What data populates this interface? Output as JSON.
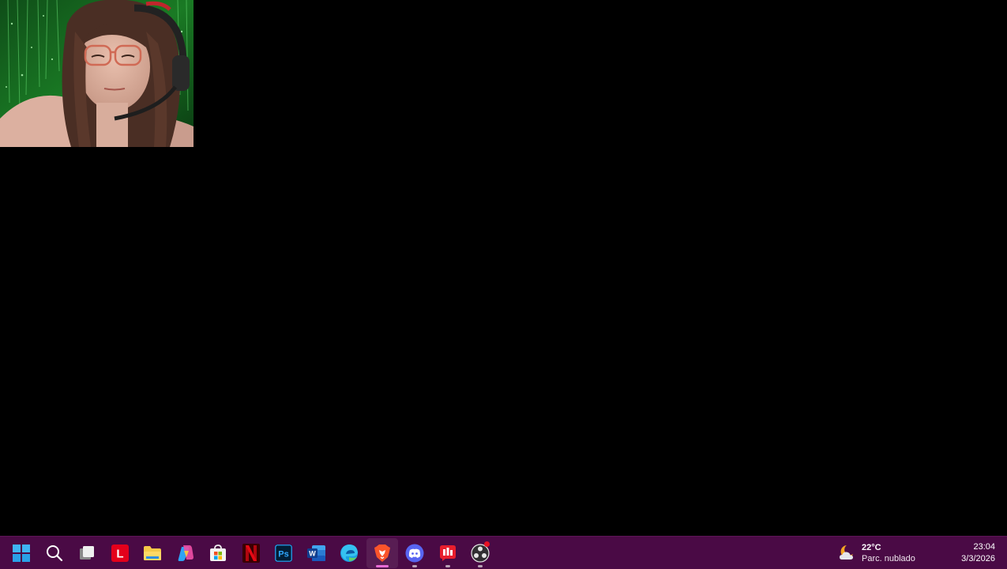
{
  "webcam": {
    "description_icon": "webcam-overlay"
  },
  "taskbar": {
    "background": "#4a0a45",
    "icons": [
      {
        "name": "start-button",
        "icon": "windows-icon",
        "running": false,
        "active": false
      },
      {
        "name": "search-button",
        "icon": "search-icon",
        "running": false,
        "active": false
      },
      {
        "name": "task-view-button",
        "icon": "task-view-icon",
        "running": false,
        "active": false
      },
      {
        "name": "taskbar-app-l",
        "icon": "l-app-icon",
        "label": "L",
        "running": false,
        "active": false
      },
      {
        "name": "taskbar-app-file-explorer",
        "icon": "folder-icon",
        "running": false,
        "active": false
      },
      {
        "name": "taskbar-app-copilot",
        "icon": "copilot-icon",
        "running": false,
        "active": false
      },
      {
        "name": "taskbar-app-store",
        "icon": "store-icon",
        "running": false,
        "active": false
      },
      {
        "name": "taskbar-app-netflix",
        "icon": "netflix-icon",
        "label": "N",
        "running": false,
        "active": false
      },
      {
        "name": "taskbar-app-photoshop",
        "icon": "photoshop-icon",
        "label": "Ps",
        "running": false,
        "active": false
      },
      {
        "name": "taskbar-app-word",
        "icon": "word-icon",
        "label": "W",
        "running": false,
        "active": false
      },
      {
        "name": "taskbar-app-edge",
        "icon": "edge-icon",
        "running": false,
        "active": false
      },
      {
        "name": "taskbar-app-brave",
        "icon": "brave-icon",
        "running": true,
        "active": true
      },
      {
        "name": "taskbar-app-discord",
        "icon": "discord-icon",
        "running": true,
        "active": false
      },
      {
        "name": "taskbar-app-red-app",
        "icon": "red-app-icon",
        "running": true,
        "active": false
      },
      {
        "name": "taskbar-app-obs",
        "icon": "obs-icon",
        "running": true,
        "active": false,
        "badge": true
      }
    ]
  },
  "weather": {
    "temperature": "22°C",
    "condition": "Parc. nublado",
    "icon": "partly-cloudy-night-icon"
  },
  "clock": {
    "time": "23:04",
    "date": "3/3/2026"
  }
}
